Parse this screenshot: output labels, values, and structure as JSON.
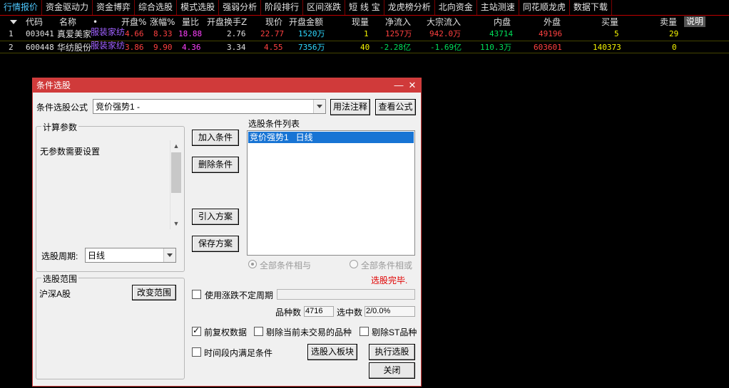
{
  "menu": {
    "tabs": [
      "行情报价",
      "资金驱动力",
      "资金博弈",
      "综合选股",
      "模式选股",
      "强弱分析",
      "阶段排行",
      "区间涨跌",
      "短 线 宝",
      "龙虎榜分析",
      "北向资金",
      "主站测速",
      "同花顺龙虎",
      "数据下载"
    ],
    "active_index": 0
  },
  "table": {
    "headers": {
      "code": "代码",
      "name": "名称",
      "dot": "•",
      "open_pct": "开盘%",
      "chg_pct": "涨幅%",
      "vol_ratio": "量比",
      "open_turnover": "开盘换手Z",
      "price": "现价",
      "open_amount": "开盘金额",
      "cur_vol": "现量",
      "net_inflow": "净流入",
      "block_inflow": "大宗流入",
      "inner": "内盘",
      "outer": "外盘",
      "buy_vol": "买量",
      "sell_vol": "卖量",
      "explain": "说明"
    },
    "rows": [
      {
        "idx": "1",
        "code": "003041",
        "name": "真爱美家",
        "sector": "服装家纺",
        "open_pct": "4.66",
        "chg_pct": "8.33",
        "vol_ratio": "18.88",
        "open_turnover": "2.76",
        "price": "22.77",
        "open_amount": "1520万",
        "cur_vol": "1",
        "net_inflow": "1257万",
        "block_inflow": "942.0万",
        "inner": "43714",
        "outer": "49196",
        "buy_vol": "5",
        "sell_vol": "29"
      },
      {
        "idx": "2",
        "code": "600448",
        "name": "华纺股份",
        "sector": "服装家纺",
        "open_pct": "3.86",
        "chg_pct": "9.90",
        "vol_ratio": "4.36",
        "open_turnover": "3.34",
        "price": "4.55",
        "open_amount": "7356万",
        "cur_vol": "40",
        "net_inflow": "-2.28亿",
        "block_inflow": "-1.69亿",
        "inner": "110.3万",
        "outer": "603601",
        "buy_vol": "140373",
        "sell_vol": "0"
      }
    ]
  },
  "dialog": {
    "title": "条件选股",
    "formula_label": "条件选股公式",
    "formula_value": "竞价强势1      -",
    "usage_button": "用法注释",
    "view_formula_button": "查看公式",
    "params_group": "计算参数",
    "params_text": "无参数需要设置",
    "period_label": "选股周期:",
    "period_value": "日线",
    "add_condition": "加入条件",
    "delete_condition": "删除条件",
    "import_plan": "引入方案",
    "save_plan": "保存方案",
    "condition_list_label": "选股条件列表",
    "condition_items": [
      "竞价强势1   日线"
    ],
    "radio_and": "全部条件相与",
    "radio_or": "全部条件相或",
    "status": "选股完毕.",
    "range_group": "选股范围",
    "range_value": "沪深A股",
    "change_range_button": "改变范围",
    "use_period_label": "使用涨跌不定周期",
    "count_label": "品种数",
    "count_value": "4716",
    "selected_label": "选中数",
    "selected_value": "2/0.0%",
    "pre_adjust_label": "前复权数据",
    "exclude_untraded_label": "剔除当前未交易的品种",
    "exclude_st_label": "剔除ST品种",
    "time_segment_label": "时间段内满足条件",
    "to_block_button": "选股入板块",
    "run_button": "执行选股",
    "close_button": "关闭",
    "minimize_icon": "—",
    "close_icon": "✕"
  }
}
